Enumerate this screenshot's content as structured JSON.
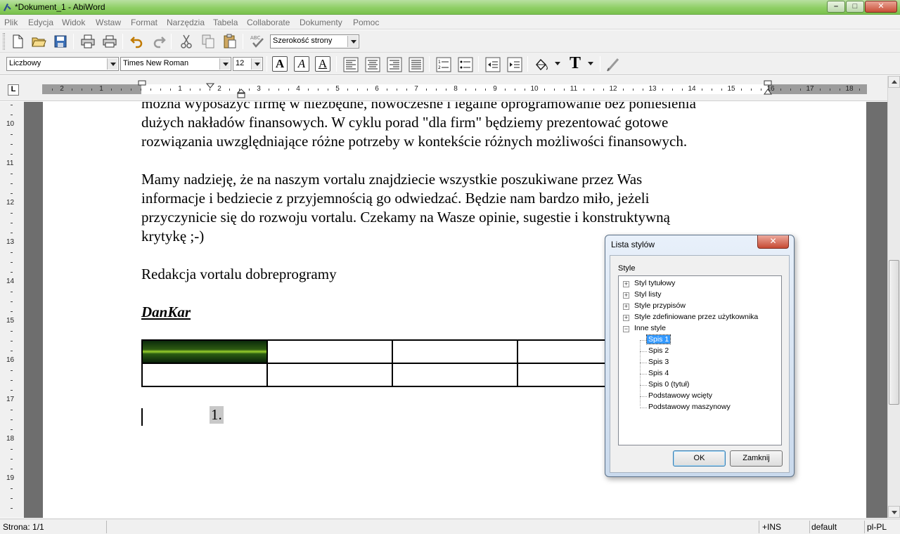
{
  "window": {
    "title": "*Dokument_1 - AbiWord",
    "min_label": "–",
    "max_label": "□",
    "close_label": "✕"
  },
  "menu": [
    "Plik",
    "Edycja",
    "Widok",
    "Wstaw",
    "Format",
    "Narzędzia",
    "Tabela",
    "Collaborate",
    "Dokumenty",
    "Pomoc"
  ],
  "toolbar1": {
    "icons": [
      "new-document-icon",
      "open-folder-icon",
      "save-icon",
      "print-icon",
      "print-preview-icon",
      "undo-icon",
      "redo-icon",
      "cut-icon",
      "copy-icon",
      "paste-icon",
      "spellcheck-icon"
    ],
    "zoom_value": "Szerokość strony"
  },
  "toolbar2": {
    "style_value": "Liczbowy",
    "font_value": "Times New Roman",
    "size_value": "12",
    "bold": "A",
    "italic": "A",
    "underline": "A",
    "text_color_label": "T"
  },
  "ruler": {
    "tab_selector": "L",
    "labels": [
      "2",
      "1",
      "1",
      "2",
      "3",
      "4",
      "5",
      "6",
      "7",
      "8",
      "9",
      "10",
      "11",
      "12",
      "13",
      "14",
      "15",
      "16",
      "17",
      "18"
    ]
  },
  "vruler": {
    "labels": [
      "10",
      "11",
      "12",
      "13",
      "14",
      "15",
      "16",
      "17",
      "18",
      "19"
    ]
  },
  "document": {
    "p1_line1": "można wyposażyć firmę w niezbędne, nowoczesne i legalne oprogramowanie bez poniesienia",
    "p1_line2": "dużych nakładów finansowych. W cyklu porad \"dla firm\" będziemy prezentować gotowe",
    "p1_line3": "rozwiązania uwzględniające różne potrzeby w kontekście różnych możliwości finansowych.",
    "p2_line1": "Mamy nadzieję, że na naszym vortalu znajdziecie wszystkie poszukiwane przez Was",
    "p2_line2": "informacje i bedziecie z przyjemnością go odwiedzać. Będzie nam bardzo miło, jeżeli",
    "p2_line3": "przyczynicie się do rozwoju vortalu. Czekamy na Wasze opinie, sugestie i konstruktywną",
    "p2_line4": "krytykę ;-)",
    "p3": "Redakcja vortalu dobreprogramy",
    "signature": "DanKar",
    "list_number": "1."
  },
  "statusbar": {
    "page": "Strona: 1/1",
    "mode": "+INS",
    "style": "default",
    "lang": "pl-PL"
  },
  "dialog": {
    "title": "Lista stylów",
    "group_label": "Style",
    "tree": [
      {
        "label": "Styl tytułowy",
        "expander": "+"
      },
      {
        "label": "Styl listy",
        "expander": "+"
      },
      {
        "label": "Style przypisów",
        "expander": "+"
      },
      {
        "label": "Style zdefiniowane przez użytkownika",
        "expander": "+"
      },
      {
        "label": "Inne style",
        "expander": "−"
      }
    ],
    "children": [
      "Spis 1",
      "Spis 2",
      "Spis 3",
      "Spis 4",
      "Spis 0 (tytuł)",
      "Podstawowy wcięty",
      "Podstawowy maszynowy"
    ],
    "ok_label": "OK",
    "close_label": "Zamknij",
    "close_x": "✕"
  }
}
